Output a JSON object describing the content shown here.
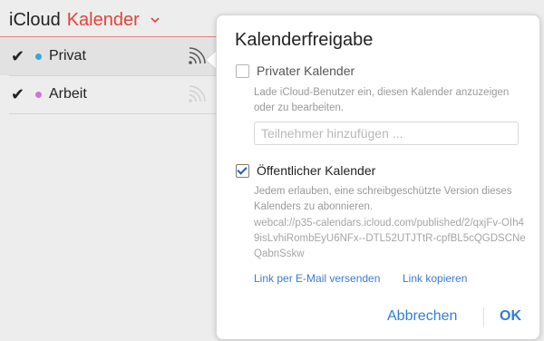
{
  "app": {
    "name": "iCloud",
    "module": "Kalender"
  },
  "sidebar": {
    "calendars": [
      {
        "label": "Privat",
        "checked": true,
        "color": "#34aadc",
        "selected": true
      },
      {
        "label": "Arbeit",
        "checked": true,
        "color": "#cc73e1",
        "selected": false
      }
    ]
  },
  "popover": {
    "title": "Kalenderfreigabe",
    "private": {
      "label": "Privater Kalender",
      "checked": false,
      "description": "Lade iCloud-Benutzer ein, diesen Kalender anzuzeigen oder zu bearbeiten.",
      "invite_placeholder": "Teilnehmer hinzufügen ..."
    },
    "public": {
      "label": "Öffentlicher Kalender",
      "checked": true,
      "description": "Jedem erlauben, eine schreibgeschützte Version dieses Kalenders zu abonnieren.",
      "url": "webcal://p35-calendars.icloud.com/published/2/qxjFv-OIh49isLvhiRombEyU6NFx--DTL52UTJTtR-cpfBL5cQGDSCNeQabnSskw",
      "link_email": "Link per E-Mail versenden",
      "link_copy": "Link kopieren"
    },
    "buttons": {
      "cancel": "Abbrechen",
      "ok": "OK"
    }
  },
  "colors": {
    "accent": "#e5413a",
    "link": "#3a7bd5"
  }
}
